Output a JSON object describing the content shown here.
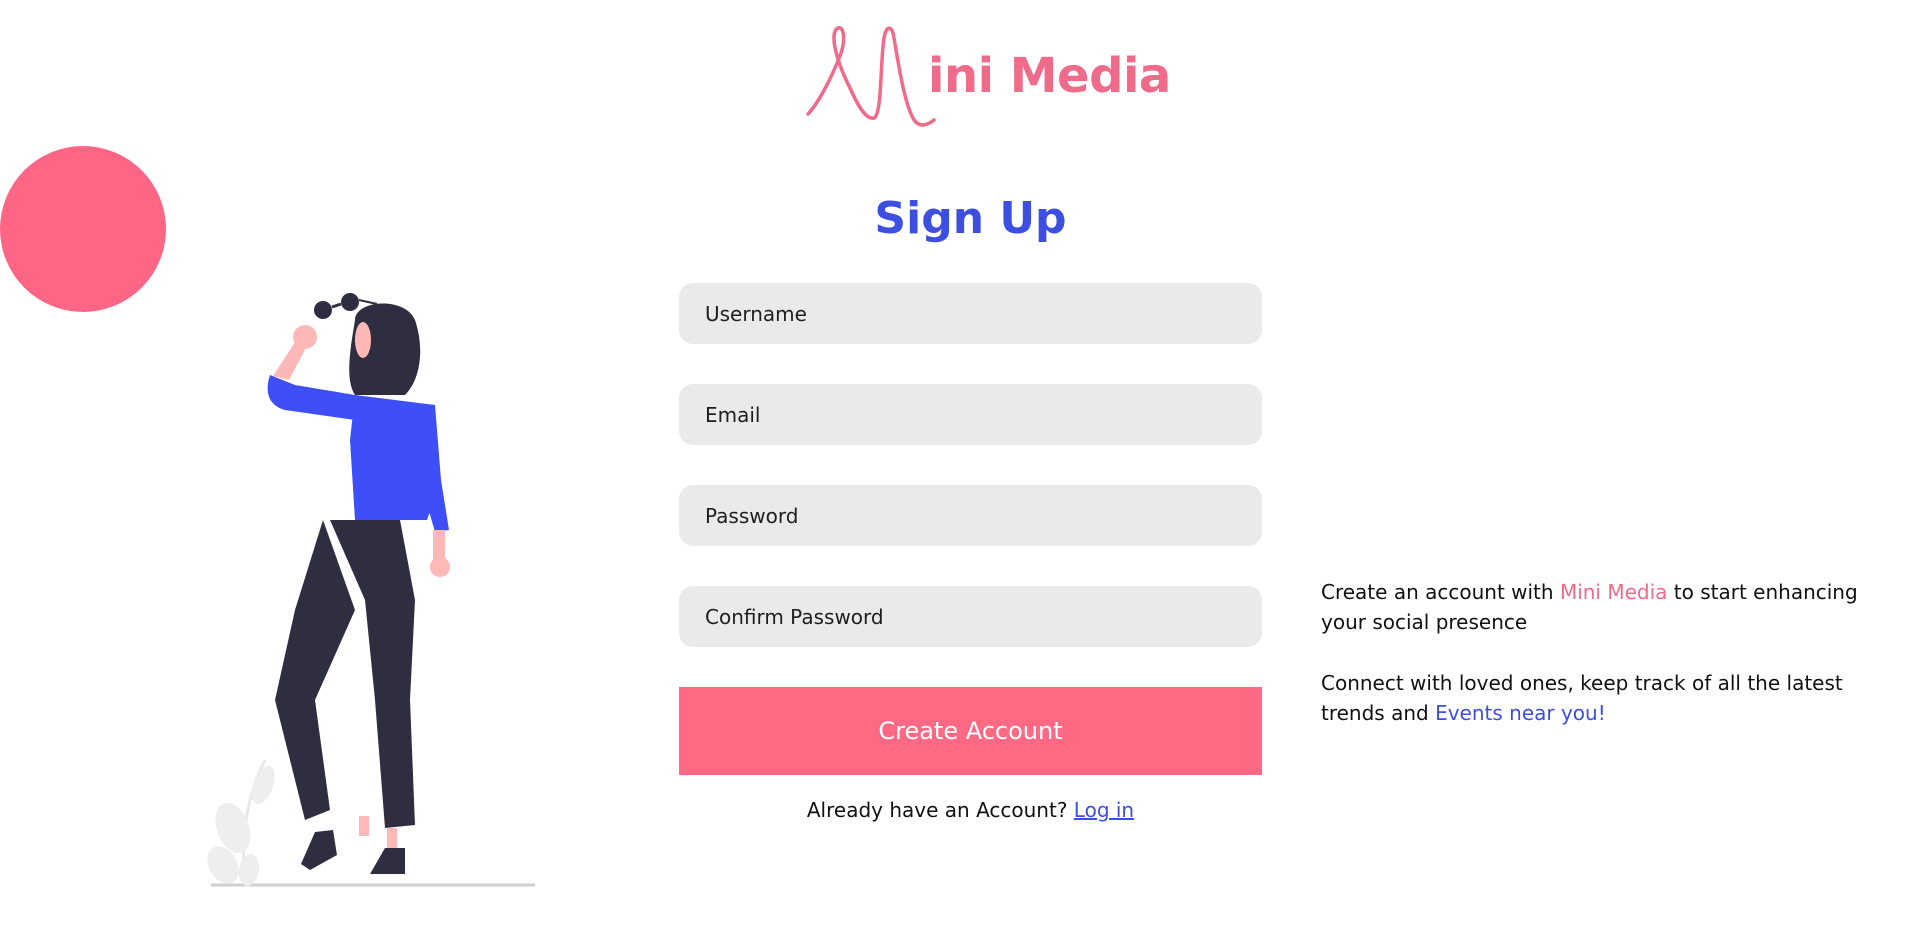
{
  "brand": {
    "name": "Mini Media",
    "logo_letter": "M",
    "logo_rest": "ini Media",
    "accent_pink": "#ff6984",
    "accent_blue": "#3d4fe0"
  },
  "form": {
    "title": "Sign Up",
    "fields": [
      {
        "name": "username",
        "placeholder": "Username",
        "value": ""
      },
      {
        "name": "email",
        "placeholder": "Email",
        "value": ""
      },
      {
        "name": "password",
        "placeholder": "Password",
        "value": ""
      },
      {
        "name": "confirm_password",
        "placeholder": "Confirm Password",
        "value": ""
      }
    ],
    "submit_label": "Create Account",
    "login_prompt": "Already have an Account?",
    "login_link": "Log in"
  },
  "side": {
    "p1_before": "Create an account with",
    "p1_highlight": "Mini Media",
    "p1_after": "to start enhancing your social presence",
    "p2_before": "Connect with loved ones, keep track of all the latest trends and",
    "p2_highlight": "Events near you!"
  },
  "illustration": {
    "icon": "woman-with-sunglasses-illustration"
  }
}
